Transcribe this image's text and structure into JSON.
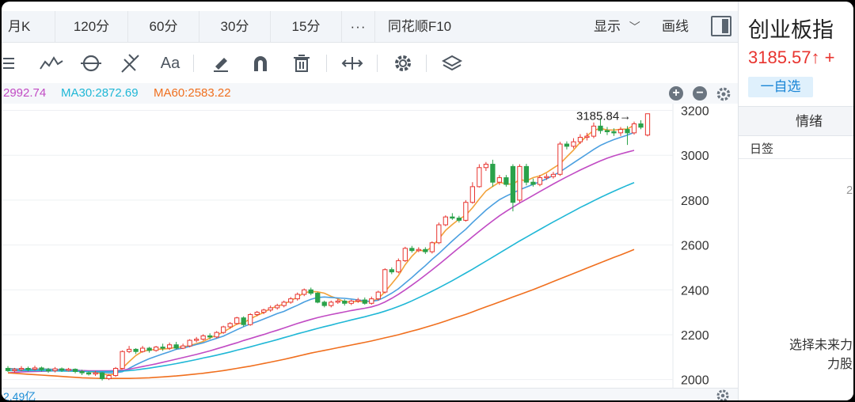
{
  "toolbar": {
    "periods": [
      "月K",
      "120分",
      "60分",
      "30分",
      "15分",
      "···",
      "同花顺F10"
    ],
    "show_label": "显示",
    "draw_label": "画线"
  },
  "tools": [
    "list-icon",
    "line-chart-icon",
    "cycle-icon",
    "fork-icon",
    "text-tool-icon",
    "eraser-icon",
    "magnet-icon",
    "trash-icon",
    "resize-icon",
    "settings-icon",
    "layers-icon"
  ],
  "tool_labels": {
    "text": "Aa"
  },
  "ma_legend": {
    "ma10": "2992.74",
    "ma30": "MA30:2872.69",
    "ma60": "MA60:2583.22"
  },
  "colors": {
    "up": "#e8342f",
    "down": "#2aa24a",
    "ma5": "#f2a23a",
    "ma10": "#4a9fe0",
    "ma20": "#c14bc4",
    "ma30": "#1fb7d6",
    "ma60": "#f06f1e"
  },
  "chart_data": {
    "type": "candlestick",
    "y_ticks": [
      "3200",
      "3000",
      "2800",
      "2600",
      "2400",
      "2200",
      "2000"
    ],
    "ylim": [
      1960,
      3230
    ],
    "max_label": "3185.84→",
    "candles": [
      [
        2050,
        2040,
        2060,
        2034
      ],
      [
        2040,
        2045,
        2052,
        2032
      ],
      [
        2045,
        2050,
        2060,
        2038
      ],
      [
        2050,
        2046,
        2058,
        2036
      ],
      [
        2046,
        2052,
        2062,
        2040
      ],
      [
        2052,
        2044,
        2058,
        2036
      ],
      [
        2044,
        2040,
        2052,
        2030
      ],
      [
        2040,
        2048,
        2056,
        2032
      ],
      [
        2048,
        2042,
        2054,
        2034
      ],
      [
        2042,
        2046,
        2052,
        2036
      ],
      [
        2046,
        2036,
        2050,
        2028
      ],
      [
        2036,
        2030,
        2044,
        2020
      ],
      [
        2030,
        2026,
        2036,
        2018
      ],
      [
        2026,
        2030,
        2038,
        2016
      ],
      [
        2030,
        2004,
        2034,
        1996
      ],
      [
        2004,
        2018,
        2024,
        1998
      ],
      [
        2018,
        2050,
        2056,
        2012
      ],
      [
        2050,
        2125,
        2130,
        2046
      ],
      [
        2125,
        2135,
        2150,
        2118
      ],
      [
        2135,
        2125,
        2140,
        2114
      ],
      [
        2125,
        2140,
        2150,
        2120
      ],
      [
        2140,
        2130,
        2146,
        2120
      ],
      [
        2130,
        2145,
        2150,
        2124
      ],
      [
        2145,
        2140,
        2160,
        2128
      ],
      [
        2140,
        2155,
        2165,
        2132
      ],
      [
        2155,
        2140,
        2168,
        2134
      ],
      [
        2140,
        2150,
        2160,
        2136
      ],
      [
        2150,
        2175,
        2180,
        2144
      ],
      [
        2175,
        2180,
        2190,
        2166
      ],
      [
        2180,
        2195,
        2202,
        2174
      ],
      [
        2195,
        2190,
        2206,
        2180
      ],
      [
        2190,
        2210,
        2216,
        2184
      ],
      [
        2210,
        2235,
        2240,
        2204
      ],
      [
        2235,
        2250,
        2256,
        2226
      ],
      [
        2250,
        2275,
        2280,
        2244
      ],
      [
        2275,
        2245,
        2282,
        2236
      ],
      [
        2245,
        2290,
        2296,
        2240
      ],
      [
        2290,
        2300,
        2306,
        2282
      ],
      [
        2300,
        2310,
        2316,
        2292
      ],
      [
        2310,
        2320,
        2330,
        2302
      ],
      [
        2320,
        2330,
        2338,
        2312
      ],
      [
        2330,
        2345,
        2352,
        2322
      ],
      [
        2345,
        2360,
        2368,
        2338
      ],
      [
        2360,
        2380,
        2388,
        2352
      ],
      [
        2380,
        2400,
        2406,
        2372
      ],
      [
        2400,
        2385,
        2410,
        2376
      ],
      [
        2385,
        2345,
        2390,
        2340
      ],
      [
        2345,
        2330,
        2352,
        2322
      ],
      [
        2330,
        2345,
        2352,
        2322
      ],
      [
        2345,
        2350,
        2360,
        2338
      ],
      [
        2350,
        2340,
        2358,
        2330
      ],
      [
        2340,
        2350,
        2356,
        2332
      ],
      [
        2350,
        2355,
        2364,
        2342
      ],
      [
        2355,
        2340,
        2366,
        2334
      ],
      [
        2340,
        2360,
        2370,
        2334
      ],
      [
        2360,
        2390,
        2396,
        2352
      ],
      [
        2390,
        2490,
        2496,
        2384
      ],
      [
        2490,
        2480,
        2500,
        2470
      ],
      [
        2480,
        2530,
        2540,
        2474
      ],
      [
        2530,
        2585,
        2592,
        2524
      ],
      [
        2585,
        2575,
        2596,
        2566
      ],
      [
        2575,
        2580,
        2590,
        2568
      ],
      [
        2580,
        2570,
        2590,
        2560
      ],
      [
        2570,
        2610,
        2616,
        2562
      ],
      [
        2610,
        2690,
        2700,
        2604
      ],
      [
        2690,
        2725,
        2732,
        2684
      ],
      [
        2725,
        2720,
        2742,
        2712
      ],
      [
        2720,
        2710,
        2730,
        2700
      ],
      [
        2710,
        2790,
        2800,
        2704
      ],
      [
        2790,
        2860,
        2880,
        2784
      ],
      [
        2860,
        2945,
        2960,
        2856
      ],
      [
        2945,
        2960,
        2970,
        2930
      ],
      [
        2960,
        2880,
        2980,
        2860
      ],
      [
        2880,
        2900,
        2912,
        2868
      ],
      [
        2900,
        2870,
        2912,
        2860
      ],
      [
        2950,
        2790,
        2960,
        2750
      ],
      [
        2800,
        2950,
        2960,
        2790
      ],
      [
        2950,
        2880,
        2962,
        2866
      ],
      [
        2880,
        2870,
        2896,
        2860
      ],
      [
        2870,
        2900,
        2912,
        2862
      ],
      [
        2900,
        2905,
        2918,
        2890
      ],
      [
        2905,
        2915,
        2926,
        2896
      ],
      [
        2915,
        3050,
        3060,
        2908
      ],
      [
        3050,
        3040,
        3062,
        3026
      ],
      [
        3040,
        3060,
        3076,
        3030
      ],
      [
        3060,
        3080,
        3094,
        3050
      ],
      [
        3080,
        3085,
        3100,
        3066
      ],
      [
        3085,
        3130,
        3146,
        3076
      ],
      [
        3130,
        3110,
        3165,
        3096
      ],
      [
        3110,
        3105,
        3126,
        3090
      ],
      [
        3105,
        3100,
        3120,
        3086
      ],
      [
        3100,
        3115,
        3126,
        3086
      ],
      [
        3115,
        3100,
        3130,
        3046
      ],
      [
        3100,
        3140,
        3150,
        3092
      ],
      [
        3140,
        3125,
        3156,
        3116
      ],
      [
        3090,
        3185,
        3186,
        3084
      ]
    ],
    "ma_series": [
      {
        "name": "MA5",
        "values": [
          2050,
          2048,
          2045,
          2044,
          2046,
          2046,
          2047,
          2044,
          2044,
          2043,
          2042,
          2039,
          2036,
          2032,
          2025,
          2021,
          2025,
          2051,
          2080,
          2107,
          2126,
          2131,
          2135,
          2136,
          2138,
          2144,
          2145,
          2152,
          2160,
          2170,
          2185,
          2198,
          2212,
          2230,
          2247,
          2254,
          2270,
          2286,
          2299,
          2317,
          2327,
          2337,
          2351,
          2368,
          2387,
          2393,
          2391,
          2385,
          2371,
          2360,
          2346,
          2346,
          2349,
          2347,
          2349,
          2360,
          2392,
          2427,
          2464,
          2512,
          2550,
          2580,
          2570,
          2593,
          2627,
          2665,
          2691,
          2715,
          2733,
          2766,
          2805,
          2841,
          2861,
          2880,
          2872,
          2871,
          2892,
          2886,
          2900,
          2908,
          2923,
          2943,
          2962,
          2993,
          3023,
          3058,
          3087,
          3111,
          3120,
          3113,
          3112,
          3116,
          3117,
          3134
        ]
      },
      {
        "name": "MA10",
        "values": [
          2048,
          2047,
          2046,
          2046,
          2046,
          2046,
          2046,
          2045,
          2045,
          2044,
          2043,
          2040,
          2038,
          2035,
          2032,
          2030,
          2030,
          2035,
          2050,
          2066,
          2080,
          2093,
          2104,
          2114,
          2124,
          2135,
          2140,
          2148,
          2156,
          2164,
          2174,
          2184,
          2194,
          2208,
          2222,
          2236,
          2248,
          2258,
          2270,
          2282,
          2294,
          2304,
          2318,
          2331,
          2346,
          2358,
          2366,
          2368,
          2366,
          2364,
          2362,
          2359,
          2355,
          2351,
          2348,
          2354,
          2368,
          2385,
          2405,
          2430,
          2455,
          2482,
          2508,
          2536,
          2562,
          2590,
          2618,
          2645,
          2670,
          2700,
          2728,
          2756,
          2780,
          2802,
          2818,
          2832,
          2846,
          2858,
          2870,
          2882,
          2895,
          2910,
          2926,
          2946,
          2966,
          2986,
          3006,
          3026,
          3044,
          3058,
          3070,
          3080,
          3090,
          3102
        ]
      },
      {
        "name": "MA20",
        "values": [
          2030,
          2032,
          2034,
          2035,
          2036,
          2037,
          2038,
          2039,
          2039,
          2040,
          2040,
          2040,
          2039,
          2039,
          2039,
          2039,
          2040,
          2042,
          2046,
          2052,
          2058,
          2064,
          2070,
          2077,
          2084,
          2091,
          2098,
          2105,
          2112,
          2120,
          2128,
          2137,
          2146,
          2155,
          2164,
          2174,
          2183,
          2192,
          2201,
          2211,
          2220,
          2230,
          2240,
          2250,
          2259,
          2268,
          2276,
          2283,
          2290,
          2296,
          2302,
          2308,
          2313,
          2318,
          2324,
          2333,
          2346,
          2362,
          2380,
          2400,
          2421,
          2443,
          2466,
          2489,
          2513,
          2538,
          2563,
          2588,
          2612,
          2637,
          2661,
          2685,
          2708,
          2730,
          2750,
          2769,
          2787,
          2804,
          2821,
          2838,
          2855,
          2872,
          2888,
          2904,
          2919,
          2934,
          2948,
          2962,
          2975,
          2987,
          2997,
          3006,
          3014,
          3022
        ]
      },
      {
        "name": "MA30",
        "values": [
          2040,
          2040,
          2040,
          2040,
          2040,
          2040,
          2039,
          2039,
          2038,
          2038,
          2037,
          2036,
          2036,
          2036,
          2036,
          2036,
          2037,
          2038,
          2040,
          2043,
          2047,
          2051,
          2056,
          2061,
          2066,
          2071,
          2077,
          2083,
          2089,
          2096,
          2102,
          2109,
          2116,
          2123,
          2131,
          2138,
          2146,
          2154,
          2162,
          2170,
          2178,
          2187,
          2195,
          2204,
          2212,
          2220,
          2228,
          2236,
          2243,
          2251,
          2258,
          2266,
          2273,
          2280,
          2288,
          2296,
          2305,
          2315,
          2326,
          2338,
          2351,
          2365,
          2379,
          2394,
          2409,
          2425,
          2441,
          2458,
          2475,
          2492,
          2510,
          2528,
          2546,
          2564,
          2582,
          2600,
          2618,
          2635,
          2652,
          2669,
          2686,
          2703,
          2719,
          2735,
          2751,
          2767,
          2782,
          2797,
          2812,
          2826,
          2840,
          2853,
          2866,
          2878
        ]
      },
      {
        "name": "MA60",
        "values": [
          2030,
          2028,
          2026,
          2024,
          2022,
          2020,
          2018,
          2016,
          2014,
          2012,
          2010,
          2008,
          2007,
          2006,
          2005,
          2005,
          2005,
          2005,
          2005,
          2006,
          2007,
          2008,
          2010,
          2012,
          2014,
          2016,
          2019,
          2022,
          2025,
          2028,
          2032,
          2036,
          2040,
          2045,
          2050,
          2055,
          2060,
          2066,
          2072,
          2078,
          2084,
          2090,
          2097,
          2104,
          2111,
          2118,
          2124,
          2130,
          2136,
          2142,
          2148,
          2154,
          2160,
          2166,
          2172,
          2179,
          2186,
          2193,
          2200,
          2208,
          2216,
          2224,
          2233,
          2242,
          2251,
          2261,
          2271,
          2281,
          2291,
          2302,
          2313,
          2324,
          2335,
          2346,
          2357,
          2368,
          2379,
          2390,
          2401,
          2413,
          2425,
          2437,
          2449,
          2461,
          2473,
          2485,
          2497,
          2509,
          2521,
          2533,
          2545,
          2556,
          2568,
          2580
        ]
      }
    ]
  },
  "bottom": {
    "volume_label": "2.49亿"
  },
  "rpanel": {
    "title": "创业板指",
    "price": "3185.57↑ +",
    "watch": "一自选",
    "tab": "情绪",
    "daily": "日签",
    "side_number": "2",
    "hint1": "选择未来力",
    "hint2": "力股"
  }
}
